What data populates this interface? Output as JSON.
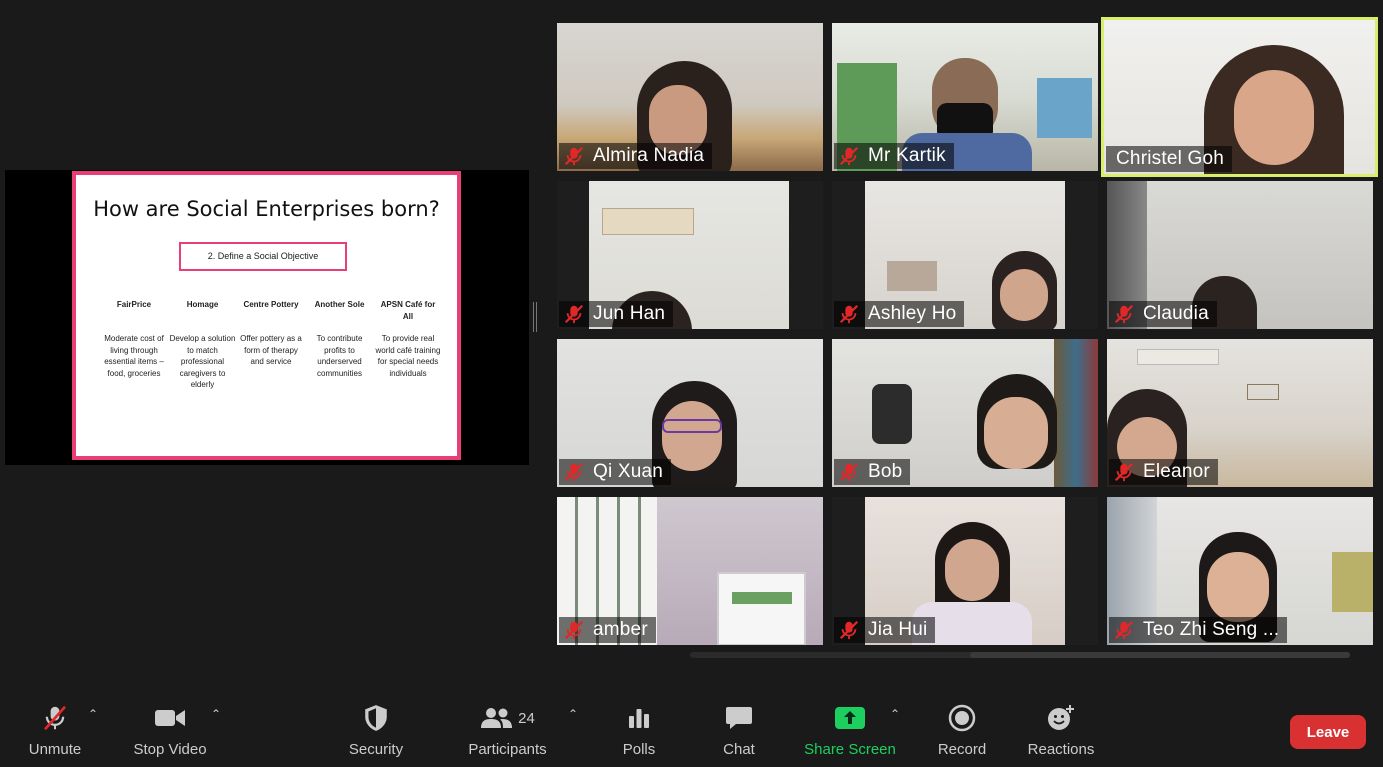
{
  "slide": {
    "title": "How are Social Enterprises born?",
    "box_text": "2. Define a Social Objective",
    "columns": [
      {
        "heading": "FairPrice",
        "body": "Moderate cost of living through essential items – food, groceries"
      },
      {
        "heading": "Homage",
        "body": "Develop a solution to match professional caregivers to elderly"
      },
      {
        "heading": "Centre Pottery",
        "body": "Offer pottery as a form of therapy and service"
      },
      {
        "heading": "Another Sole",
        "body": "To contribute profits to underserved communities"
      },
      {
        "heading": "APSN Café for All",
        "body": "To provide real world café training for special needs individuals"
      }
    ]
  },
  "participants": [
    {
      "name": "Almira Nadia",
      "muted": true
    },
    {
      "name": "Mr Kartik",
      "muted": true
    },
    {
      "name": "Christel Goh",
      "muted": false,
      "active_speaker": true
    },
    {
      "name": "Jun Han",
      "muted": true
    },
    {
      "name": "Ashley Ho",
      "muted": true
    },
    {
      "name": "Claudia",
      "muted": true
    },
    {
      "name": "Qi Xuan",
      "muted": true
    },
    {
      "name": "Bob",
      "muted": true
    },
    {
      "name": "Eleanor",
      "muted": true
    },
    {
      "name": "amber",
      "muted": true
    },
    {
      "name": "Jia Hui",
      "muted": true
    },
    {
      "name": "Teo Zhi Seng ...",
      "muted": true
    }
  ],
  "toolbar": {
    "unmute": "Unmute",
    "stop_video": "Stop Video",
    "security": "Security",
    "participants": "Participants",
    "participants_count": "24",
    "polls": "Polls",
    "chat": "Chat",
    "share_screen": "Share Screen",
    "record": "Record",
    "reactions": "Reactions",
    "leave": "Leave"
  },
  "colors": {
    "slide_border": "#e83e7a",
    "active_speaker": "#d7ef6a",
    "muted_icon": "#e02828",
    "share_green": "#1ccf5e",
    "leave_red": "#d93131"
  }
}
